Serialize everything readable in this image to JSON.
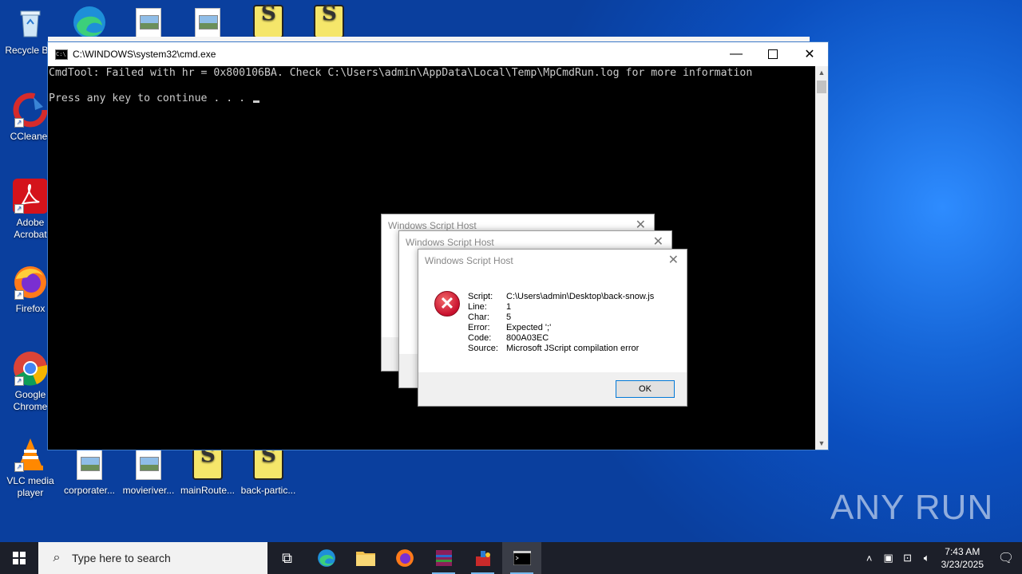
{
  "desktop": {
    "icons": [
      {
        "label": "Recycle Bin",
        "icon": "recycle-bin-icon"
      },
      {
        "label": "CCleaner",
        "icon": "ccleaner-icon"
      },
      {
        "label": "Adobe Acrobat",
        "icon": "adobe-acrobat-icon"
      },
      {
        "label": "Firefox",
        "icon": "firefox-icon"
      },
      {
        "label": "Google Chrome",
        "icon": "chrome-icon"
      },
      {
        "label": "VLC media player",
        "icon": "vlc-icon"
      }
    ],
    "bottom_files": [
      {
        "label": "corporater...",
        "icon": "image-file-icon"
      },
      {
        "label": "movieriver...",
        "icon": "image-file-icon"
      },
      {
        "label": "mainRoute...",
        "icon": "script-file-icon"
      },
      {
        "label": "back-partic...",
        "icon": "script-file-icon"
      }
    ]
  },
  "cmd_window": {
    "title": "C:\\WINDOWS\\system32\\cmd.exe",
    "line1": "CmdTool: Failed with hr = 0x800106BA. Check C:\\Users\\admin\\AppData\\Local\\Temp\\MpCmdRun.log for more information",
    "line2": "Press any key to continue . . . "
  },
  "dialogs": {
    "title": "Windows Script Host",
    "front": {
      "rows": [
        {
          "key": "Script:",
          "value": "C:\\Users\\admin\\Desktop\\back-snow.js"
        },
        {
          "key": "Line:",
          "value": "1"
        },
        {
          "key": "Char:",
          "value": "5"
        },
        {
          "key": "Error:",
          "value": "Expected ';'"
        },
        {
          "key": "Code:",
          "value": "800A03EC"
        },
        {
          "key": "Source:",
          "value": "Microsoft JScript compilation error"
        }
      ],
      "ok_label": "OK"
    }
  },
  "watermark": "ANY RUN",
  "taskbar": {
    "search_placeholder": "Type here to search",
    "time": "7:43 AM",
    "date": "3/23/2025"
  },
  "colors": {
    "desktop_blue": "#0b4fbf",
    "taskbar": "#1c1f29",
    "console_text": "#cccccc",
    "accent": "#0078d7"
  }
}
